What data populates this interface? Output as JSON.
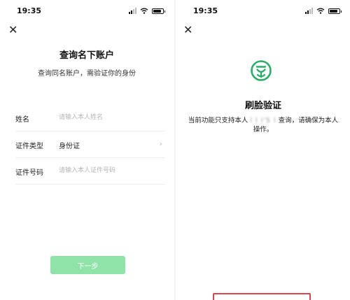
{
  "left": {
    "status": {
      "time": "19:35"
    },
    "close_glyph": "✕",
    "title": "查询名下账户",
    "subtitle": "查询同名账户，需验证你的身份",
    "fields": [
      {
        "label": "姓名",
        "placeholder": "请输入本人姓名"
      },
      {
        "label": "证件类型",
        "value": "身份证",
        "chevron": "›"
      },
      {
        "label": "证件号码",
        "placeholder": "请输入本人证件号码"
      }
    ],
    "next_button": "下一步",
    "colors": {
      "button_bg": "#8fe3a9"
    }
  },
  "right": {
    "status": {
      "time": "19:35"
    },
    "close_glyph": "✕",
    "icon": "face-verify-icon",
    "title": "刷脸验证",
    "desc_prefix": "当前功能只支持本人",
    "desc_blurred": "l l i'S l",
    "desc_suffix": "查询，请确保为本人操作。",
    "colors": {
      "accent": "#2aae67",
      "highlight_box": "#d64550"
    }
  }
}
